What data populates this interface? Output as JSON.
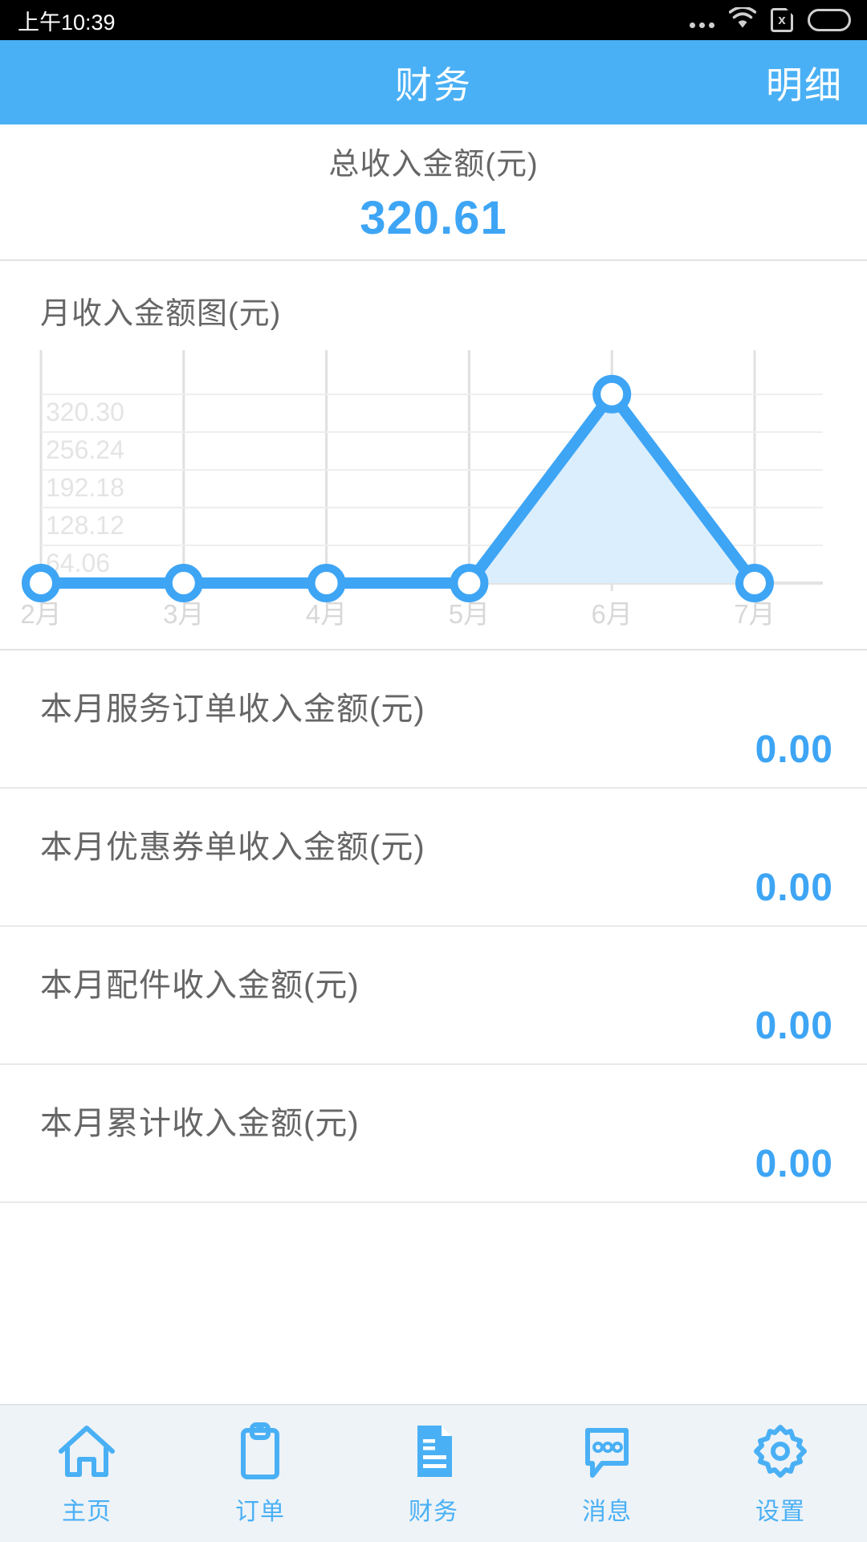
{
  "status_bar": {
    "time": "上午10:39",
    "icons": [
      "more-dots-icon",
      "wifi-icon",
      "sim-no-card-icon",
      "battery-icon"
    ]
  },
  "header": {
    "title": "财务",
    "action_label": "明细",
    "bg_color": "#4ab0f5"
  },
  "summary": {
    "label": "总收入金额(元)",
    "value": "320.61",
    "value_color": "#3ea5f5"
  },
  "chart_section": {
    "title": "月收入金额图(元)"
  },
  "chart_data": {
    "type": "area",
    "title": "月收入金额图(元)",
    "xlabel": "",
    "ylabel": "",
    "categories": [
      "2月",
      "3月",
      "4月",
      "5月",
      "6月",
      "7月"
    ],
    "values": [
      0,
      0,
      0,
      0,
      320.61,
      0
    ],
    "ytick_labels": [
      "320.30",
      "256.24",
      "192.18",
      "128.12",
      "64.06"
    ],
    "ytick_values": [
      320.3,
      256.24,
      192.18,
      128.12,
      64.06
    ],
    "ylim": [
      0,
      384.36
    ],
    "grid": true,
    "legend": "none",
    "line_color": "#3ea5f5",
    "fill_color": "#dbeefd",
    "marker": "open-circle"
  },
  "rows": [
    {
      "label": "本月服务订单收入金额(元)",
      "value": "0.00"
    },
    {
      "label": "本月优惠券单收入金额(元)",
      "value": "0.00"
    },
    {
      "label": "本月配件收入金额(元)",
      "value": "0.00"
    },
    {
      "label": "本月累计收入金额(元)",
      "value": "0.00"
    }
  ],
  "tabbar": {
    "items": [
      {
        "label": "主页",
        "icon": "home-icon",
        "active": false
      },
      {
        "label": "订单",
        "icon": "clipboard-icon",
        "active": false
      },
      {
        "label": "财务",
        "icon": "document-icon",
        "active": true
      },
      {
        "label": "消息",
        "icon": "chat-icon",
        "active": false
      },
      {
        "label": "设置",
        "icon": "gear-icon",
        "active": false
      }
    ],
    "accent_color": "#4ab0f5"
  }
}
